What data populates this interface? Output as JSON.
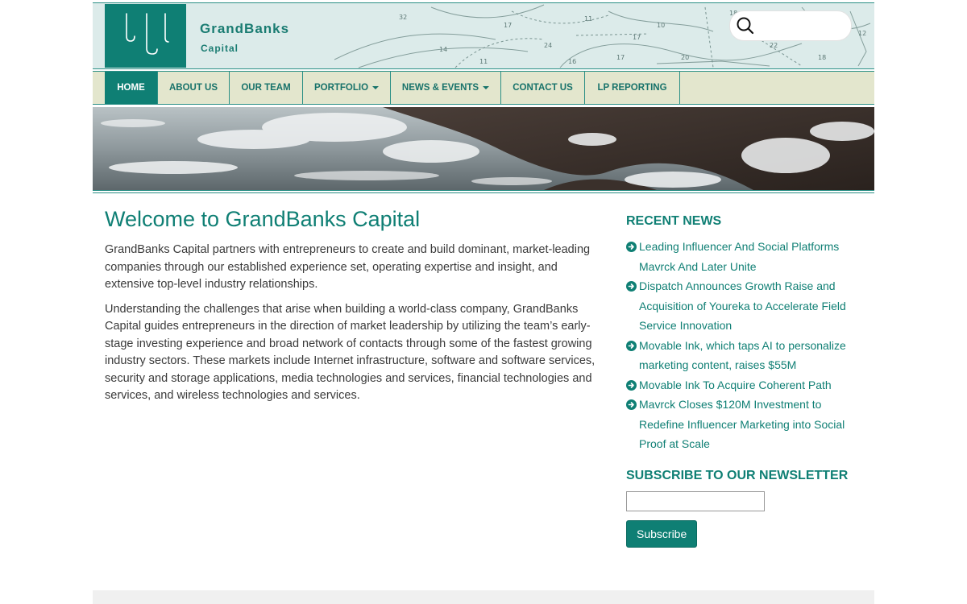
{
  "brand": {
    "name": "GrandBanks",
    "sub": "Capital"
  },
  "search": {
    "placeholder": "",
    "icon": "search-icon"
  },
  "nav": {
    "items": [
      {
        "label": "HOME",
        "active": true
      },
      {
        "label": "ABOUT US"
      },
      {
        "label": "OUR TEAM"
      },
      {
        "label": "PORTFOLIO",
        "dropdown": true
      },
      {
        "label": "NEWS & EVENTS",
        "dropdown": true
      },
      {
        "label": "CONTACT US"
      },
      {
        "label": "LP REPORTING"
      }
    ]
  },
  "main": {
    "title": "Welcome to GrandBanks Capital",
    "paragraphs": [
      "GrandBanks Capital partners with entrepreneurs to create and build dominant, market-leading companies through our established experience set, operating expertise and insight, and extensive top-level industry relationships.",
      "Understanding the challenges that arise when building a world-class company, GrandBanks Capital guides entrepreneurs in the direction of market leadership by utilizing the team’s early-stage investing experience and broad network of contacts through some of the fastest growing industry sectors. These markets include Internet infrastructure, software and software services, security and storage applications, media technologies and services, financial technologies and services, and wireless technologies and services."
    ]
  },
  "sidebar": {
    "recent_news_title": "RECENT NEWS",
    "news": [
      "Leading Influencer And Social Platforms Mavrck And Later Unite",
      "Dispatch Announces Growth Raise and Acquisition of Youreka to Accelerate Field Service Innovation",
      "Movable Ink, which taps AI to personalize marketing content, raises $55M",
      "Movable Ink To Acquire Coherent Path",
      "Mavrck Closes $120M Investment to Redefine Influencer Marketing into Social Proof at Scale"
    ],
    "newsletter_title": "SUBSCRIBE TO OUR NEWSLETTER",
    "email_value": "",
    "subscribe_label": "Subscribe"
  },
  "colors": {
    "brand_teal": "#0f7f74",
    "nav_bg": "#e3e6cd"
  }
}
